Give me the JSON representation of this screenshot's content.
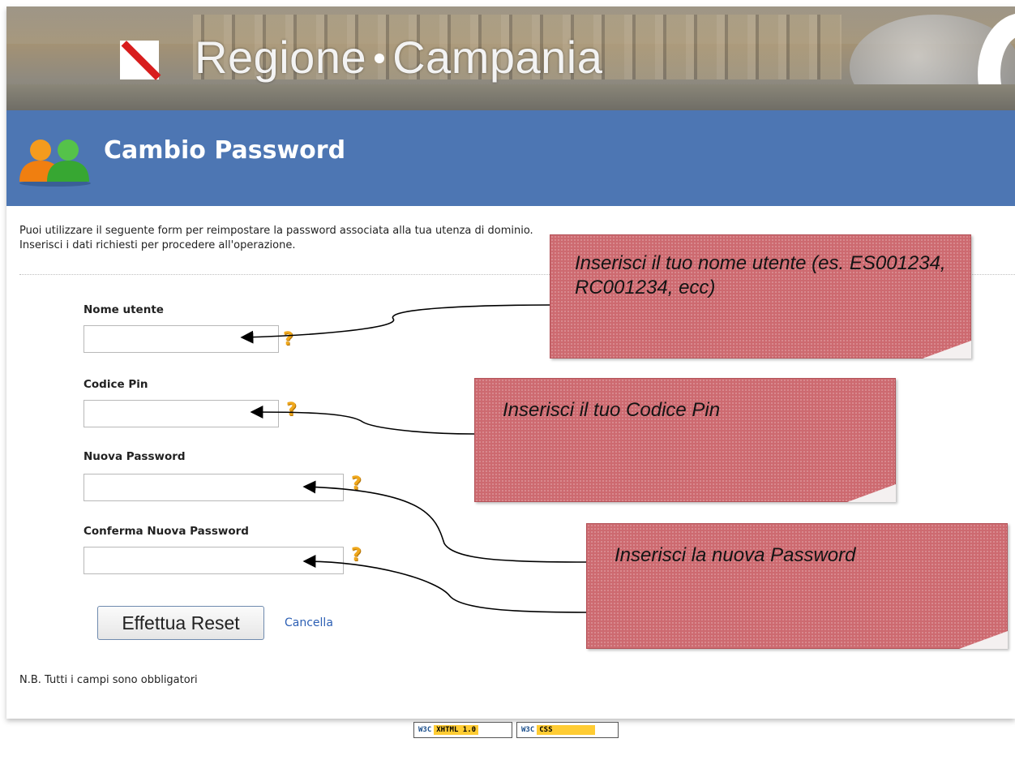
{
  "header": {
    "brand_part1": "Regione",
    "brand_part2": "Campania"
  },
  "title_bar": {
    "title": "Cambio Password",
    "icon": "users-icon"
  },
  "intro": {
    "line1": "Puoi utilizzare il seguente form per reimpostare la password associata alla tua utenza di dominio.",
    "line2": "Inserisci i dati richiesti per procedere all'operazione."
  },
  "form": {
    "username": {
      "label": "Nome utente",
      "value": ""
    },
    "pin": {
      "label": "Codice Pin",
      "value": ""
    },
    "new_password": {
      "label": "Nuova Password",
      "value": ""
    },
    "confirm_password": {
      "label": "Conferma Nuova Password",
      "value": ""
    },
    "help_glyph": "?",
    "submit_label": "Effettua Reset",
    "cancel_label": "Cancella"
  },
  "footnote": "N.B. Tutti i campi sono obbligatori",
  "badges": [
    {
      "w3c": "W3C",
      "name": "XHTML 1.0"
    },
    {
      "w3c": "W3C",
      "name": "CSS"
    }
  ],
  "callouts": {
    "username_note": "Inserisci il tuo nome utente (es. ES001234, RC001234, ecc)",
    "pin_note": "Inserisci il tuo Codice Pin",
    "password_note": "Inserisci la nuova Password"
  },
  "colors": {
    "title_bar": "#4d76b3",
    "note_fill": "#cd6a70",
    "help_icon": "#f0a81c",
    "link": "#2c5fb4"
  }
}
